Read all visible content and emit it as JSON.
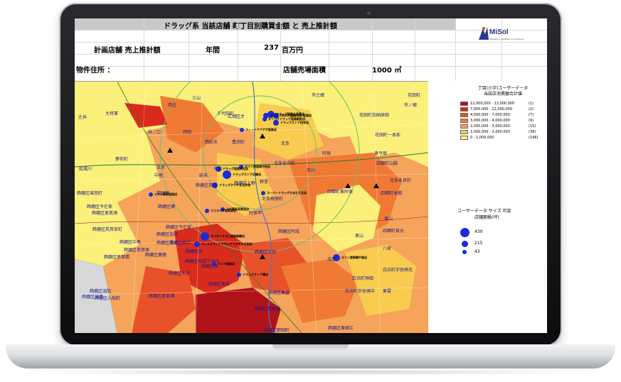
{
  "sheet": {
    "title": "ドラッグ系  当該店舗  町丁目別購買金額  と  売上推計額",
    "logo": {
      "text": "MiSol",
      "subtext": "Marketing Intelligence Solutions"
    },
    "fields": {
      "plan_store_label": "計画店舗  売上推計額",
      "period_label": "年間",
      "sales_value": "237",
      "sales_unit": "百万円",
      "address_label": "物件住所  ：",
      "floor_area_label": "店舗売場面積",
      "floor_area_value": "1000 ㎡"
    }
  },
  "legend": {
    "title_line1": "丁目(小字)ユーザーデータ",
    "title_line2": "当該店消費額合計値",
    "classes": [
      {
        "range": "12,000,000 - 13,000,000",
        "count": "(1)",
        "color": "#b0121a"
      },
      {
        "range": "7,000,000 - 12,000,000",
        "count": "(2)",
        "color": "#d92b1c"
      },
      {
        "range": "4,000,000 - 7,000,000",
        "count": "(7)",
        "color": "#e8522a"
      },
      {
        "range": "3,000,000 - 4,000,000",
        "count": "(9)",
        "color": "#f07a34"
      },
      {
        "range": "2,000,000 - 3,000,000",
        "count": "(15)",
        "color": "#f5a45a"
      },
      {
        "range": "1,000,000 - 2,000,000",
        "count": "(38)",
        "color": "#f9cc50"
      },
      {
        "range": "0 - 1,000,000",
        "count": "(146)",
        "color": "#fbf07a"
      }
    ],
    "size_title_line1": "ユーザーデータ サイズ 可変",
    "size_title_line2": "店舗面積(坪)",
    "sizes": [
      {
        "label": "430",
        "level": 1.0
      },
      {
        "label": "215",
        "level": 0.6
      },
      {
        "label": "43",
        "level": 0.3
      }
    ]
  },
  "map": {
    "store_color": "#1a2bd8",
    "place_labels": [
      "花田町",
      "市ノ郷",
      "花田町加納原田",
      "市之郷",
      "花田町一本松",
      "土山",
      "西庄",
      "千代田町",
      "大将軍",
      "広畑区才",
      "辻井",
      "井ノ口",
      "岡田",
      "西延末",
      "豊沢町",
      "北条",
      "阿保",
      "東今宿",
      "夢前町",
      "中地",
      "延末",
      "今宿",
      "北条宮の町",
      "市川",
      "四郷町山脇",
      "飾磨区上野",
      "玉手",
      "船場川",
      "飾磨区英賀",
      "野里",
      "北条梅原町",
      "四郷町東阿保",
      "北条永良町",
      "四郷町本郷",
      "飾磨区城南町",
      "御国野",
      "飾磨区今在家",
      "飾磨区構",
      "飾磨区恵美酒",
      "阿保甲",
      "飾磨区英賀宮町",
      "東山",
      "四郷町坂元",
      "飾磨区加茂",
      "飾磨区清水",
      "飾磨区中島",
      "飾磨区阿成",
      "奥山",
      "飾磨区思案橋",
      "飾磨区英賀保",
      "飾磨区細江",
      "飾磨区宮",
      "飾磨区三宅",
      "北原",
      "飾磨区妻鹿",
      "白浜町神田",
      "飾磨区阿成下垣内",
      "白浜町宇佐崎中",
      "飾磨区須加",
      "飾磨区入船町",
      "飾磨区今在家",
      "飾磨区東",
      "飾磨区東雲",
      "飾磨区大浜",
      "東雲",
      "白浜町宇佐崎北",
      "八家",
      "飾磨区恵美酒",
      "飾磨区東堀",
      "飾磨区思案橋",
      "飾磨区野田町",
      "飾磨区東細江",
      "飾磨区須磨"
    ],
    "stores": [
      "ドラッグストア姫路北店",
      "フィットケアデポ姫路店",
      "ドラッグ姫路大将軍店",
      "ココカラファイン姫路店",
      "ドラッグストア田寺店",
      "ダイコクドラッグ姫路駅前店",
      "ドラッグ姫路米田店",
      "ドラッグストア広峰店",
      "キリン堂姫路中地店",
      "スーパードラッグひまわり北店",
      "ドラッグかつやま玉手店",
      "エキム薬局姫路店",
      "スギ薬局英賀保店",
      "ウエルシア姫路宮店",
      "マツモトキヨシ姫路飾磨店",
      "ディスカウントドラッグコスモス花田店",
      "マスヤ姫路店",
      "キリン堂飾磨中島店",
      "ドラッグストア構店"
    ]
  }
}
